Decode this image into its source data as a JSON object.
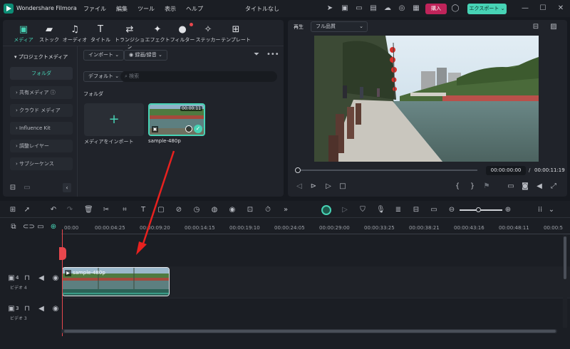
{
  "app": {
    "name": "Wondershare Filmora",
    "doc_title": "タイトルなし"
  },
  "menu": [
    "ファイル",
    "編集",
    "ツール",
    "表示",
    "ヘルプ"
  ],
  "buttons": {
    "purchase": "購入",
    "export": "エクスポート"
  },
  "toolbar_tabs": [
    {
      "label": "メディア",
      "icon": "media-icon"
    },
    {
      "label": "ストック",
      "icon": "stock-icon"
    },
    {
      "label": "オーディオ",
      "icon": "music-icon"
    },
    {
      "label": "タイトル",
      "icon": "title-icon"
    },
    {
      "label": "トランジション",
      "icon": "transition-icon"
    },
    {
      "label": "エフェクト",
      "icon": "effect-icon"
    },
    {
      "label": "フィルター",
      "icon": "filter-icon"
    },
    {
      "label": "ステッカー",
      "icon": "sticker-icon"
    },
    {
      "label": "テンプレート",
      "icon": "template-icon"
    }
  ],
  "sidebar": {
    "project_media": "プロジェクトメディア",
    "folder": "フォルダ",
    "items": [
      "共有メディア",
      "クラウド メディア",
      "Influence Kit",
      "調整レイヤー",
      "サブシーケンス"
    ]
  },
  "media_toolbar": {
    "import": "インポート",
    "record": "録画/録音",
    "sort": "デフォルト",
    "search_placeholder": "検索"
  },
  "folder_label": "フォルダ",
  "media_items": [
    {
      "label": "メディアをインポート"
    },
    {
      "label": "sample-480p",
      "duration": "00:00:11"
    }
  ],
  "preview": {
    "tab": "再生",
    "quality": "フル品質",
    "current_time": "00:00:00:00",
    "separator": "/",
    "total_time": "00:00:11:19"
  },
  "ruler": [
    "00:00",
    "00:00:04:25",
    "00:00:09:20",
    "00:00:14:15",
    "00:00:19:10",
    "00:00:24:05",
    "00:00:29:00",
    "00:00:33:25",
    "00:00:38:21",
    "00:00:43:16",
    "00:00:48:11",
    "00:00:5"
  ],
  "tracks": [
    {
      "num": "4",
      "name": "ビデオ 4"
    },
    {
      "num": "3",
      "name": "ビデオ 3"
    }
  ],
  "clip": {
    "label": "sample-480p"
  },
  "colors": {
    "accent": "#47d3b5",
    "purchase": "#c0245a",
    "arrow": "#e8211f",
    "playhead": "#e8474d"
  }
}
